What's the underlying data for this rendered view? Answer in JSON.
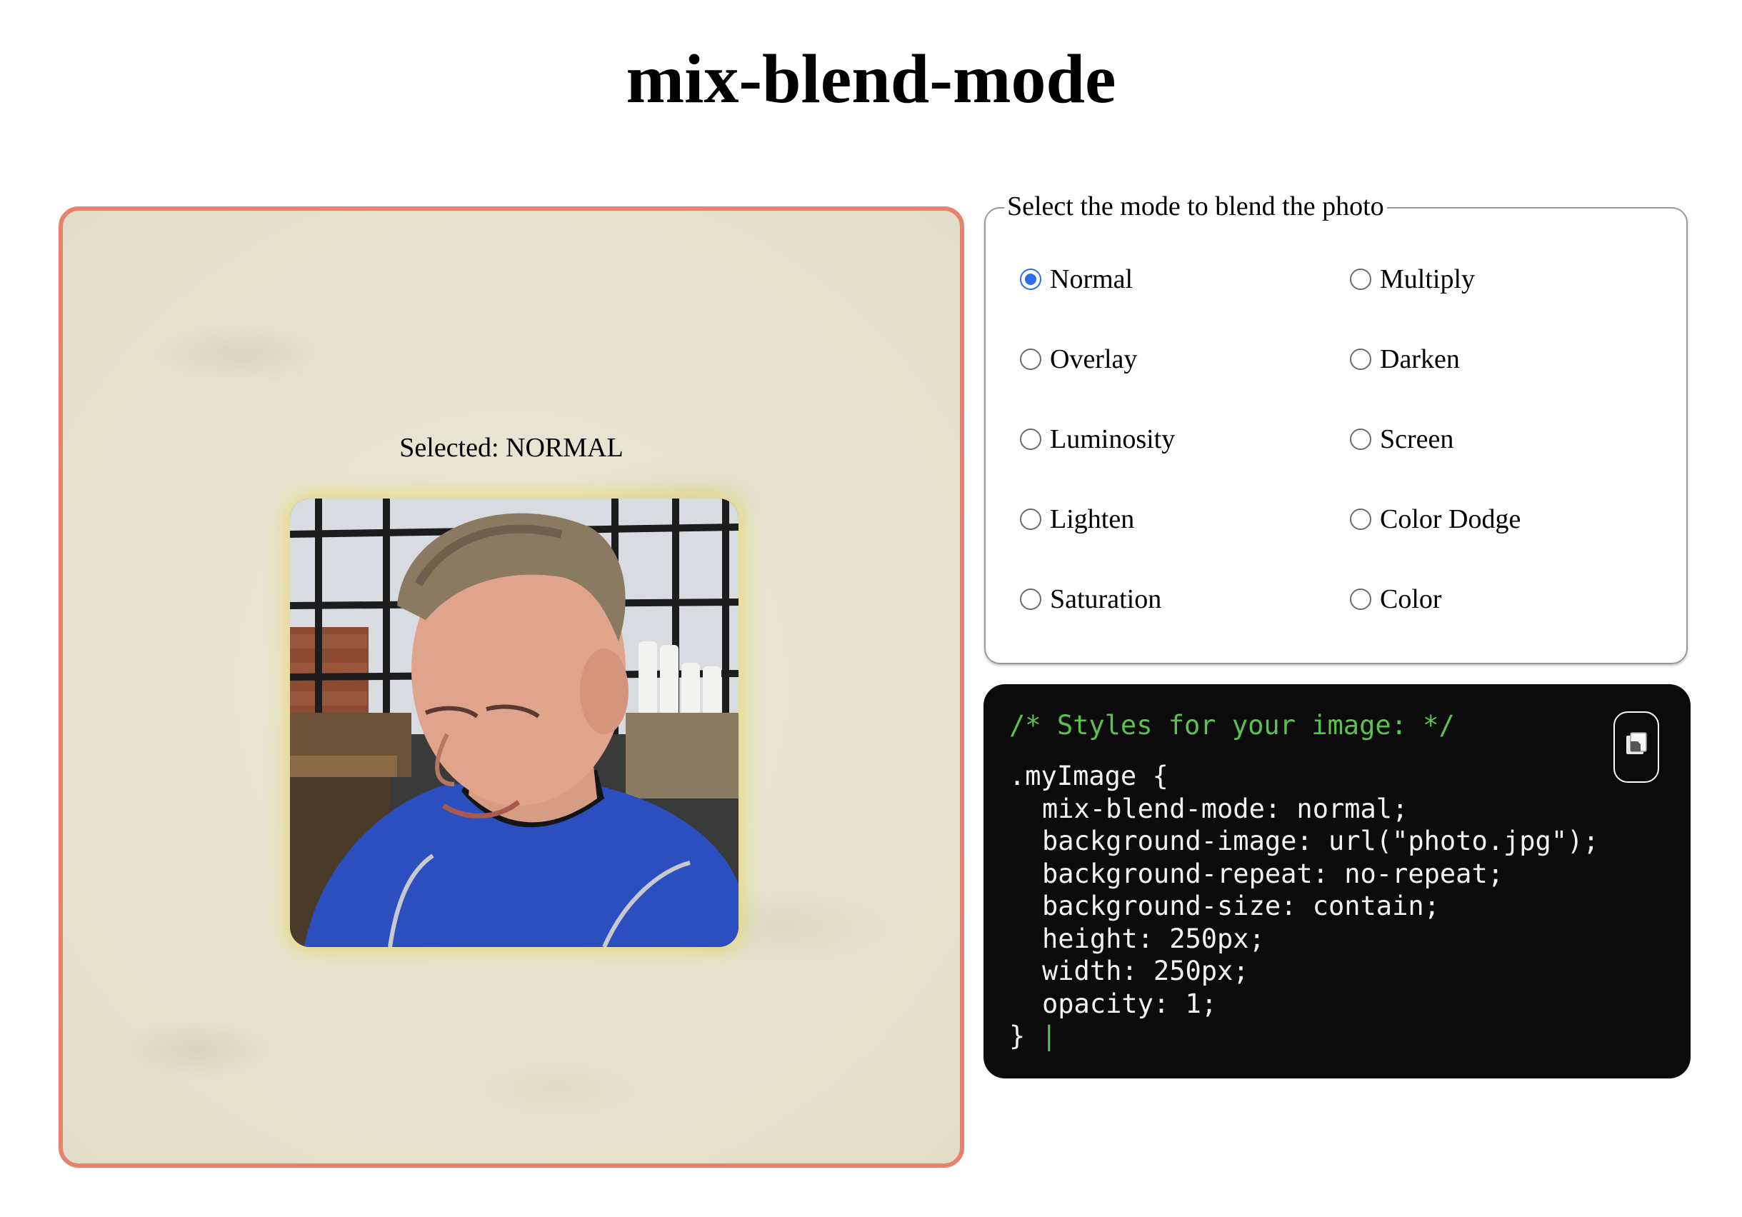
{
  "page": {
    "title": "mix-blend-mode"
  },
  "preview": {
    "selected_text": "Selected: NORMAL",
    "image_alt": "photo"
  },
  "modes": {
    "legend": "Select the mode to blend the photo",
    "options": [
      {
        "label": "Normal",
        "checked": true
      },
      {
        "label": "Multiply",
        "checked": false
      },
      {
        "label": "Overlay",
        "checked": false
      },
      {
        "label": "Darken",
        "checked": false
      },
      {
        "label": "Luminosity",
        "checked": false
      },
      {
        "label": "Screen",
        "checked": false
      },
      {
        "label": "Lighten",
        "checked": false
      },
      {
        "label": "Color Dodge",
        "checked": false
      },
      {
        "label": "Saturation",
        "checked": false
      },
      {
        "label": "Color",
        "checked": false
      }
    ]
  },
  "code": {
    "comment": "/* Styles for your image: */",
    "lines": [
      ".myImage {",
      "mix-blend-mode: normal;",
      "background-image: url(\"photo.jpg\");",
      "background-repeat: no-repeat;",
      "background-size: contain;",
      "height: 250px;",
      "width: 250px;",
      "opacity: 1;",
      "}"
    ],
    "cursor": "|",
    "copy_icon": "copy-icon"
  },
  "colors": {
    "panel_border": "#e5836f",
    "radio_accent": "#2f6de8",
    "code_bg": "#0b0b0b",
    "code_comment": "#5cc151",
    "photo_glow": "#e6d76e"
  }
}
